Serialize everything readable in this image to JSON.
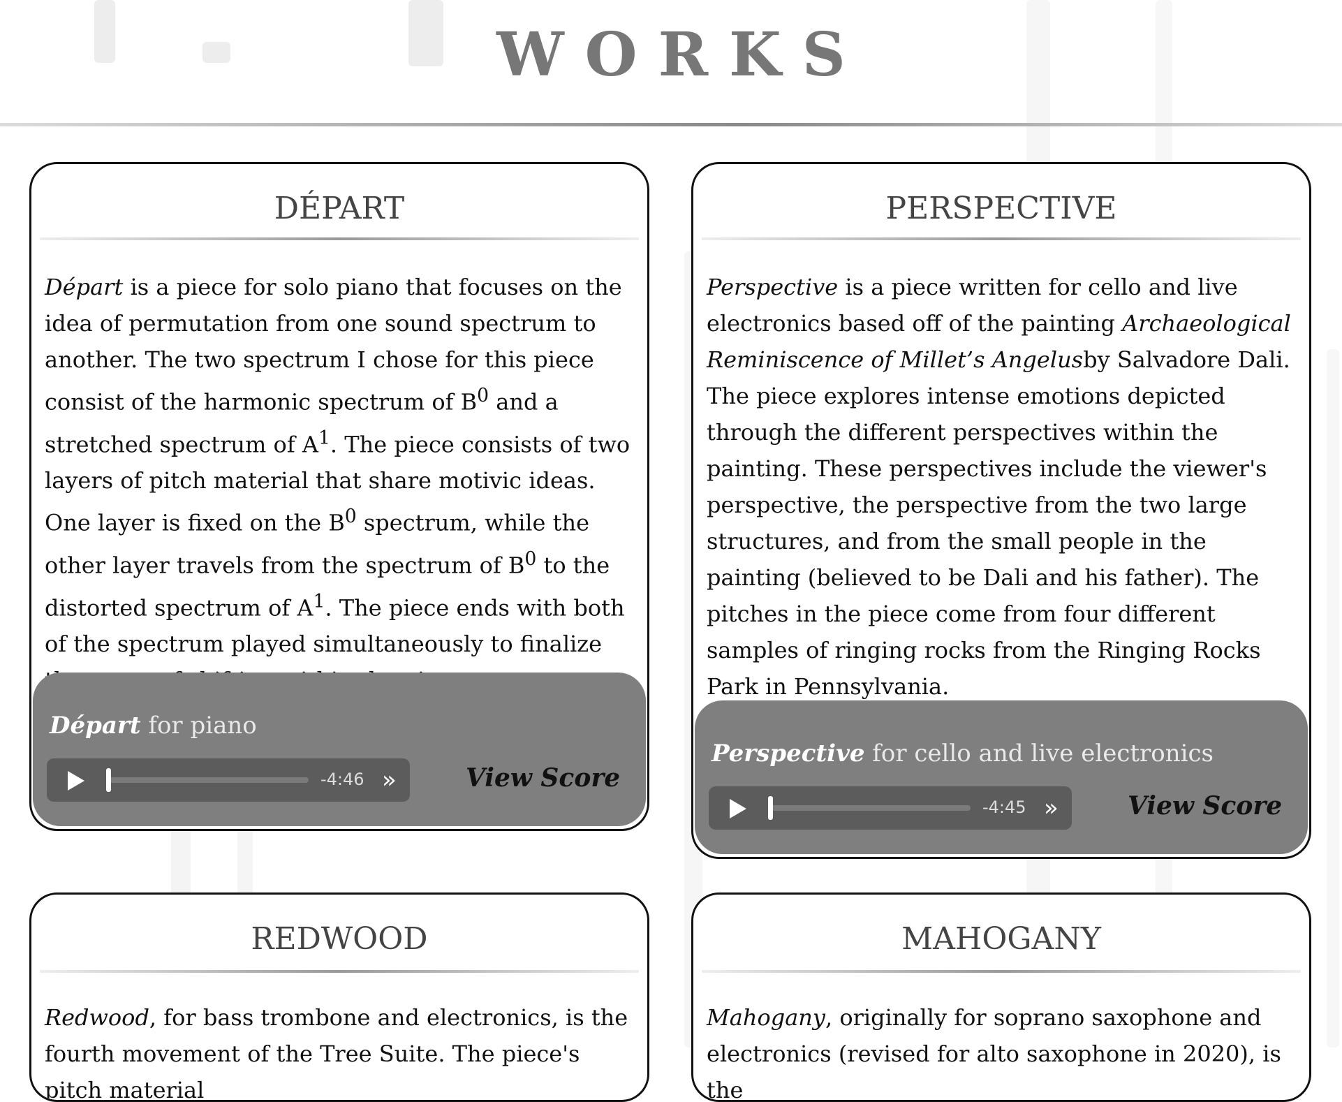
{
  "page": {
    "title": "WORKS"
  },
  "works": [
    {
      "title": "DÉPART",
      "desc_html": "<i>Départ</i> is a piece for solo piano that focuses on the idea of permutation from one sound spectrum to another. The two spectrum I chose for this piece consist of the harmonic spectrum of B<sup>0</sup> and a stretched spectrum of A<sup>1</sup>. The piece consists of two layers of pitch material that share motivic ideas. One layer is fixed on the B<sup>0</sup> spectrum, while the other layer travels from the spectrum of B<sup>0</sup> to the distorted spectrum of A<sup>1</sup>. The piece ends with both of the spectrum played simultaneously to finalize the sense of shifting within the piece.",
      "player": {
        "title": "Départ",
        "subtitle": " for piano",
        "time": "-4:46"
      },
      "view_score": "View Score"
    },
    {
      "title": "PERSPECTIVE",
      "desc_html": "<i>Perspective</i> is a piece written for cello and live electronics based off of the painting <i>Archaeological Reminiscence of Millet’s Angelus</i>by Salvadore Dali. The piece explores intense emotions depicted through the different perspectives within the painting. These perspectives include the viewer's perspective, the perspective from the two large structures, and from the small people in the painting (believed to be Dali and his father). The pitches in the piece come from four different samples of ringing rocks from the Ringing Rocks Park in Pennsylvania.",
      "player": {
        "title": "Perspective",
        "subtitle": " for cello and live electronics",
        "time": "-4:45"
      },
      "view_score": "View Score"
    },
    {
      "title": "REDWOOD",
      "desc_html": "<i>Redwood</i>, for bass trombone and electronics, is the fourth movement of the Tree Suite. The piece's pitch material"
    },
    {
      "title": "MAHOGANY",
      "desc_html": "<i>Mahogany</i>, originally for soprano saxophone and electronics (revised for alto saxophone in 2020), is the"
    }
  ],
  "icons": {
    "play": "play-icon",
    "forward": "skip-forward-icon"
  }
}
